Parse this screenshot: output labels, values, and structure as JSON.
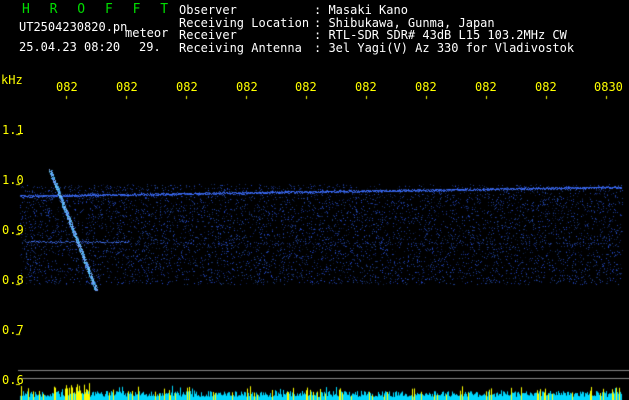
{
  "header": {
    "brand": "H R O F F T",
    "filename": "UT2504230820.pn",
    "meteor_label": "meteor",
    "datetime": "25.04.23 08:20",
    "count": "29."
  },
  "info": [
    {
      "label": "Observer",
      "value": ": Masaki Kano"
    },
    {
      "label": "Receiving Location",
      "value": ": Shibukawa, Gunma, Japan"
    },
    {
      "label": "Receiver",
      "value": ": RTL-SDR SDR# 43dB L15 103.2MHz CW"
    },
    {
      "label": "Receiving Antenna",
      "value": ": 3el Yagi(V) Az 330 for Vladivostok"
    }
  ],
  "time_ticks": [
    "082",
    "082",
    "082",
    "082",
    "082",
    "082",
    "082",
    "082",
    "082",
    "0830"
  ],
  "freq_axis": {
    "unit": "kHz",
    "ticks": [
      "1.1",
      "1.0",
      "0.9",
      "0.8",
      "0.7",
      "0.6"
    ]
  },
  "colors": {
    "background": "#000000",
    "axis": "#ffff00",
    "brand": "#00dd00",
    "signal": "#2a5cff",
    "spectrum_bar": "#00e0ff"
  }
}
